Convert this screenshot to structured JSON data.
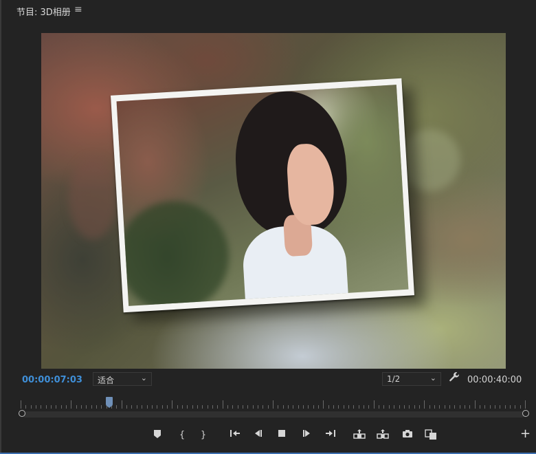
{
  "panel": {
    "title": "节目: 3D相册",
    "menu_icon": "hamburger-icon",
    "menu_glyph": "≡"
  },
  "viewer": {
    "content": "photo"
  },
  "controls": {
    "current_time": "00:00:07:03",
    "zoom": {
      "value": "适合",
      "chevron": "⌄"
    },
    "resolution": {
      "value": "1/2",
      "chevron": "⌄"
    },
    "settings_icon": "wrench-icon",
    "duration": "00:00:40:00"
  },
  "timeline": {
    "playhead_position_fraction": 0.176
  },
  "transport": [
    {
      "name": "add-marker-button",
      "icon": "marker-icon"
    },
    {
      "name": "mark-in-button",
      "icon": "mark-in-icon",
      "glyph": "{"
    },
    {
      "name": "mark-out-button",
      "icon": "mark-out-icon",
      "glyph": "}"
    },
    {
      "name": "go-to-in-button",
      "icon": "go-to-in-icon"
    },
    {
      "name": "step-back-button",
      "icon": "step-back-icon"
    },
    {
      "name": "stop-button",
      "icon": "stop-icon"
    },
    {
      "name": "step-forward-button",
      "icon": "step-forward-icon"
    },
    {
      "name": "go-to-out-button",
      "icon": "go-to-out-icon"
    },
    {
      "name": "lift-button",
      "icon": "lift-icon"
    },
    {
      "name": "extract-button",
      "icon": "extract-icon"
    },
    {
      "name": "export-frame-button",
      "icon": "camera-icon"
    },
    {
      "name": "comparison-view-button",
      "icon": "compare-icon"
    }
  ],
  "add_button": {
    "icon": "plus-icon",
    "glyph": "+"
  },
  "colors": {
    "background": "#232323",
    "timecode_accent": "#3f8fd8",
    "playhead": "#6f90b8",
    "focus_border": "#3d6fb0"
  }
}
